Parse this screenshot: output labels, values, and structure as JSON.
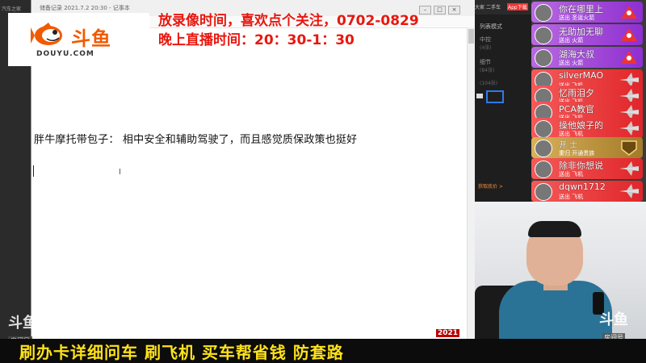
{
  "left_strip": {
    "text": "汽车之家"
  },
  "notepad": {
    "title": "储备记录 2021.7.2 20:30 - 记事本",
    "content_line": "胖牛摩托带包子：  相中安全和辅助驾驶了，而且感觉质保政策也挺好"
  },
  "logo": {
    "brand_cn": "斗鱼",
    "brand_en": "DOUYU.COM"
  },
  "announcement": {
    "line1": "放录像时间，喜欢点个关注，0702-0829",
    "line2": "晚上直播时间：20：30-1：30"
  },
  "right_app": {
    "top_items": [
      "大家",
      "二手车",
      "App下载"
    ],
    "mode_label": "列表模式",
    "items": [
      {
        "label": "中控",
        "sub": "(4张)"
      },
      {
        "label": "细节",
        "sub": "(84张)"
      }
    ],
    "count": "(104张)",
    "link": "获取底价 >"
  },
  "gifts": [
    {
      "user": "你在哪里上",
      "action": "送出 圣诞火箭",
      "style": "purple",
      "icon": "rocket-icon"
    },
    {
      "user": "无助加无聊",
      "action": "送出 火箭",
      "style": "purple",
      "icon": "rocket-icon"
    },
    {
      "user": "湖海大叔",
      "action": "送出 火箭",
      "style": "purple",
      "icon": "rocket-icon"
    },
    {
      "user": "silverMAO",
      "action": "送出 飞机",
      "style": "red",
      "icon": "plane-icon"
    },
    {
      "user": "忆雨泪夕",
      "action": "送出 飞机",
      "style": "red",
      "icon": "plane-icon"
    },
    {
      "user": "PCA教官",
      "action": "送出 飞机",
      "style": "red",
      "icon": "plane-icon"
    },
    {
      "user": "操他娘子的",
      "action": "送出 飞机",
      "style": "red",
      "icon": "plane-icon"
    },
    {
      "user": "开 士",
      "action": "重归 开通贵族",
      "style": "gold",
      "icon": "noble-badge-icon"
    },
    {
      "user": "除非你想说",
      "action": "送出 飞机",
      "style": "red",
      "icon": "plane-icon"
    },
    {
      "user": "dqwn1712",
      "action": "送出 飞机",
      "style": "red",
      "icon": "plane-icon"
    }
  ],
  "watermark_left": {
    "brand": "斗鱼",
    "tag": "房间号"
  },
  "watermark_right": {
    "brand": "斗鱼",
    "tag": "房间号",
    "room": "549040"
  },
  "year_badge": "2021",
  "ticker": "刷办卡详细问车  刷飞机 买车帮省钱  防套路",
  "colors": {
    "announcement": "#e8170f",
    "ticker": "#ffe21a",
    "gift_purple": "#a24fd8",
    "gift_red": "#e8363a",
    "gift_gold": "#c09a44",
    "douyu_orange": "#f25a00"
  }
}
